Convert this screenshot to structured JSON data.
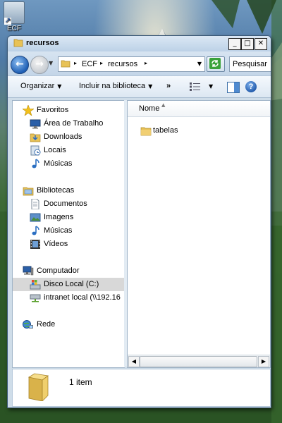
{
  "desktop": {
    "icon_label": "ECF"
  },
  "window": {
    "title": "recursos",
    "controls": {
      "minimize": "_",
      "maximize": "□",
      "close": "✕"
    }
  },
  "address": {
    "breadcrumbs": [
      "ECF",
      "recursos"
    ],
    "search_placeholder": "Pesquisar"
  },
  "toolbar": {
    "organize": "Organizar",
    "include_library": "Incluir na biblioteca",
    "more": "»"
  },
  "sidebar": {
    "favorites": {
      "label": "Favoritos",
      "items": [
        "Área de Trabalho",
        "Downloads",
        "Locais",
        "Músicas"
      ]
    },
    "libraries": {
      "label": "Bibliotecas",
      "items": [
        "Documentos",
        "Imagens",
        "Músicas",
        "Vídeos"
      ]
    },
    "computer": {
      "label": "Computador",
      "items": [
        "Disco Local (C:)",
        "intranet local (\\\\192.16"
      ],
      "selected_index": 0
    },
    "network": {
      "label": "Rede"
    }
  },
  "content": {
    "column_name": "Nome",
    "items": [
      {
        "name": "tabelas",
        "type": "folder"
      }
    ]
  },
  "details": {
    "count_text": "1 item"
  },
  "colors": {
    "folder": "#e8c256",
    "accent": "#1f5fb5",
    "selection": "#d8d8d8"
  }
}
